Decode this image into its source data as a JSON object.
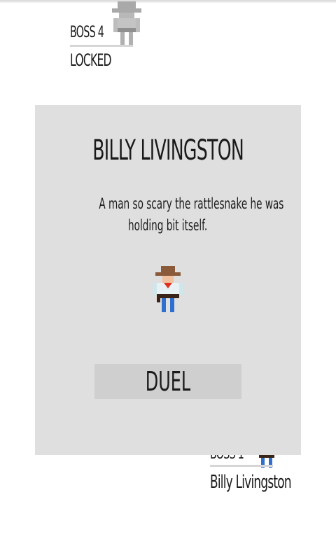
{
  "bosses": [
    {
      "number_label": "BOSS 4",
      "name_label": "LOCKED",
      "locked": true
    },
    {
      "number_label": "BOSS 1",
      "name_label": "Billy Livingston",
      "locked": false
    }
  ],
  "dialog": {
    "title": "BILLY LIVINGSTON",
    "description_line1": "A man so scary the rattlesnake he was",
    "description_line2": "holding bit itself.",
    "duel_label": "DUEL"
  },
  "icons": [
    "locked-boss-sprite-icon",
    "cowboy-sprite-icon"
  ],
  "colors": {
    "dialog_bg": "#dfdfdf",
    "button_bg": "#cfcfcf",
    "locked_sprite": "#a9a9a9",
    "hat_brown": "#8a5a3a",
    "jeans_blue": "#2f6fd0",
    "bandana_red": "#e03020"
  }
}
